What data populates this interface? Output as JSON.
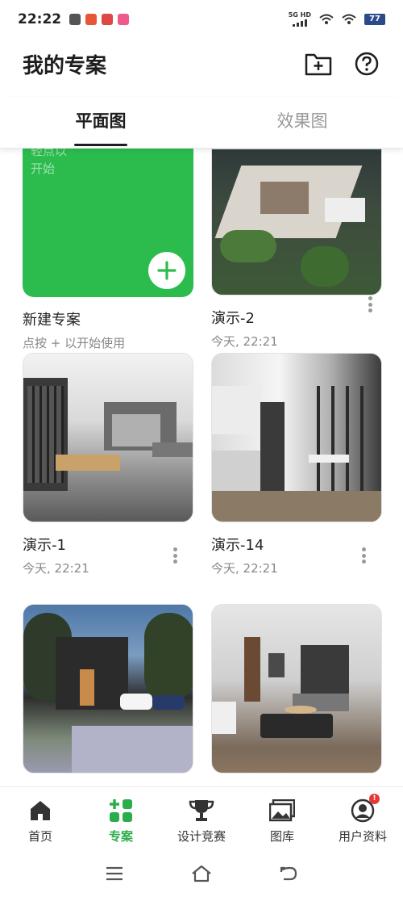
{
  "status_bar": {
    "time": "22:22",
    "network": "5G HD",
    "battery": "77"
  },
  "header": {
    "title": "我的专案"
  },
  "tabs": [
    {
      "label": "平面图",
      "active": true
    },
    {
      "label": "效果图",
      "active": false
    }
  ],
  "new_project": {
    "hint_line1": "轻点以",
    "hint_line2": "开始",
    "name": "新建专案",
    "subtitle": "点按 + 以开始使用"
  },
  "projects": [
    {
      "name": "演示-2",
      "date": "今天, 22:21"
    },
    {
      "name": "演示-1",
      "date": "今天, 22:21"
    },
    {
      "name": "演示-14",
      "date": "今天, 22:21"
    }
  ],
  "bottom_nav": [
    {
      "label": "首页",
      "icon": "home-icon",
      "active": false
    },
    {
      "label": "专案",
      "icon": "projects-icon",
      "active": true
    },
    {
      "label": "设计竞赛",
      "icon": "trophy-icon",
      "active": false
    },
    {
      "label": "图库",
      "icon": "gallery-icon",
      "active": false
    },
    {
      "label": "用户资料",
      "icon": "profile-icon",
      "active": false,
      "badge": "!"
    }
  ],
  "colors": {
    "accent": "#2bbc4d",
    "active_nav": "#2bae4a",
    "badge": "#e53935"
  }
}
